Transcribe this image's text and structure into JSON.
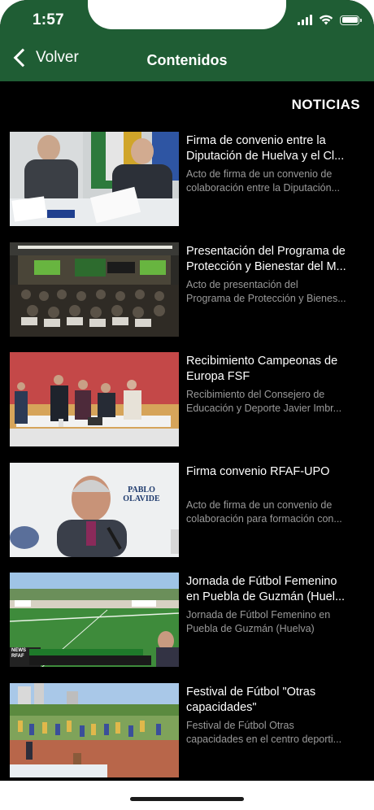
{
  "status": {
    "time": "1:57"
  },
  "nav": {
    "back_label": "Volver",
    "title": "Contenidos"
  },
  "section": {
    "title": "NOTICIAS"
  },
  "news": [
    {
      "title_line1": "Firma de convenio entre la",
      "title_line2": "Diputación de Huelva y el Cl...",
      "desc_line1": "Acto de firma de un convenio de",
      "desc_line2": "colaboración entre la Diputación...",
      "thumb_text": ""
    },
    {
      "title_line1": "Presentación del Programa de",
      "title_line2": "Protección y Bienestar del M...",
      "desc_line1": "Acto de presentación del",
      "desc_line2": "Programa de Protección y Bienes...",
      "thumb_text": ""
    },
    {
      "title_line1": "Recibimiento Campeonas de",
      "title_line2": "Europa FSF",
      "desc_line1": "Recibimiento del Consejero de",
      "desc_line2": "Educación y Deporte Javier Imbr...",
      "thumb_text": ""
    },
    {
      "title_line1": "Firma convenio RFAF-UPO",
      "title_line2": "",
      "desc_line1": "Acto de firma de un convenio de",
      "desc_line2": "colaboración para formación con...",
      "thumb_text": "PABLO OLAVIDE"
    },
    {
      "title_line1": "Jornada de Fútbol Femenino",
      "title_line2": "en Puebla de Guzmán (Huel...",
      "desc_line1": "Jornada de Fútbol Femenino en",
      "desc_line2": "Puebla de Guzmán (Huelva)",
      "thumb_text": "NEWS RFAF"
    },
    {
      "title_line1": "Festival de Fútbol \"Otras",
      "title_line2": "capacidades\"",
      "desc_line1": "Festival de Fútbol  Otras",
      "desc_line2": "capacidades en el centro deporti...",
      "thumb_text": ""
    }
  ],
  "colors": {
    "header": "#1f5d34",
    "background": "#000000",
    "title_text": "#ffffff",
    "desc_text": "#9a9a9a"
  },
  "icons": {
    "back": "chevron-left-icon",
    "signal": "cellular-signal-icon",
    "wifi": "wifi-icon",
    "battery": "battery-icon"
  }
}
